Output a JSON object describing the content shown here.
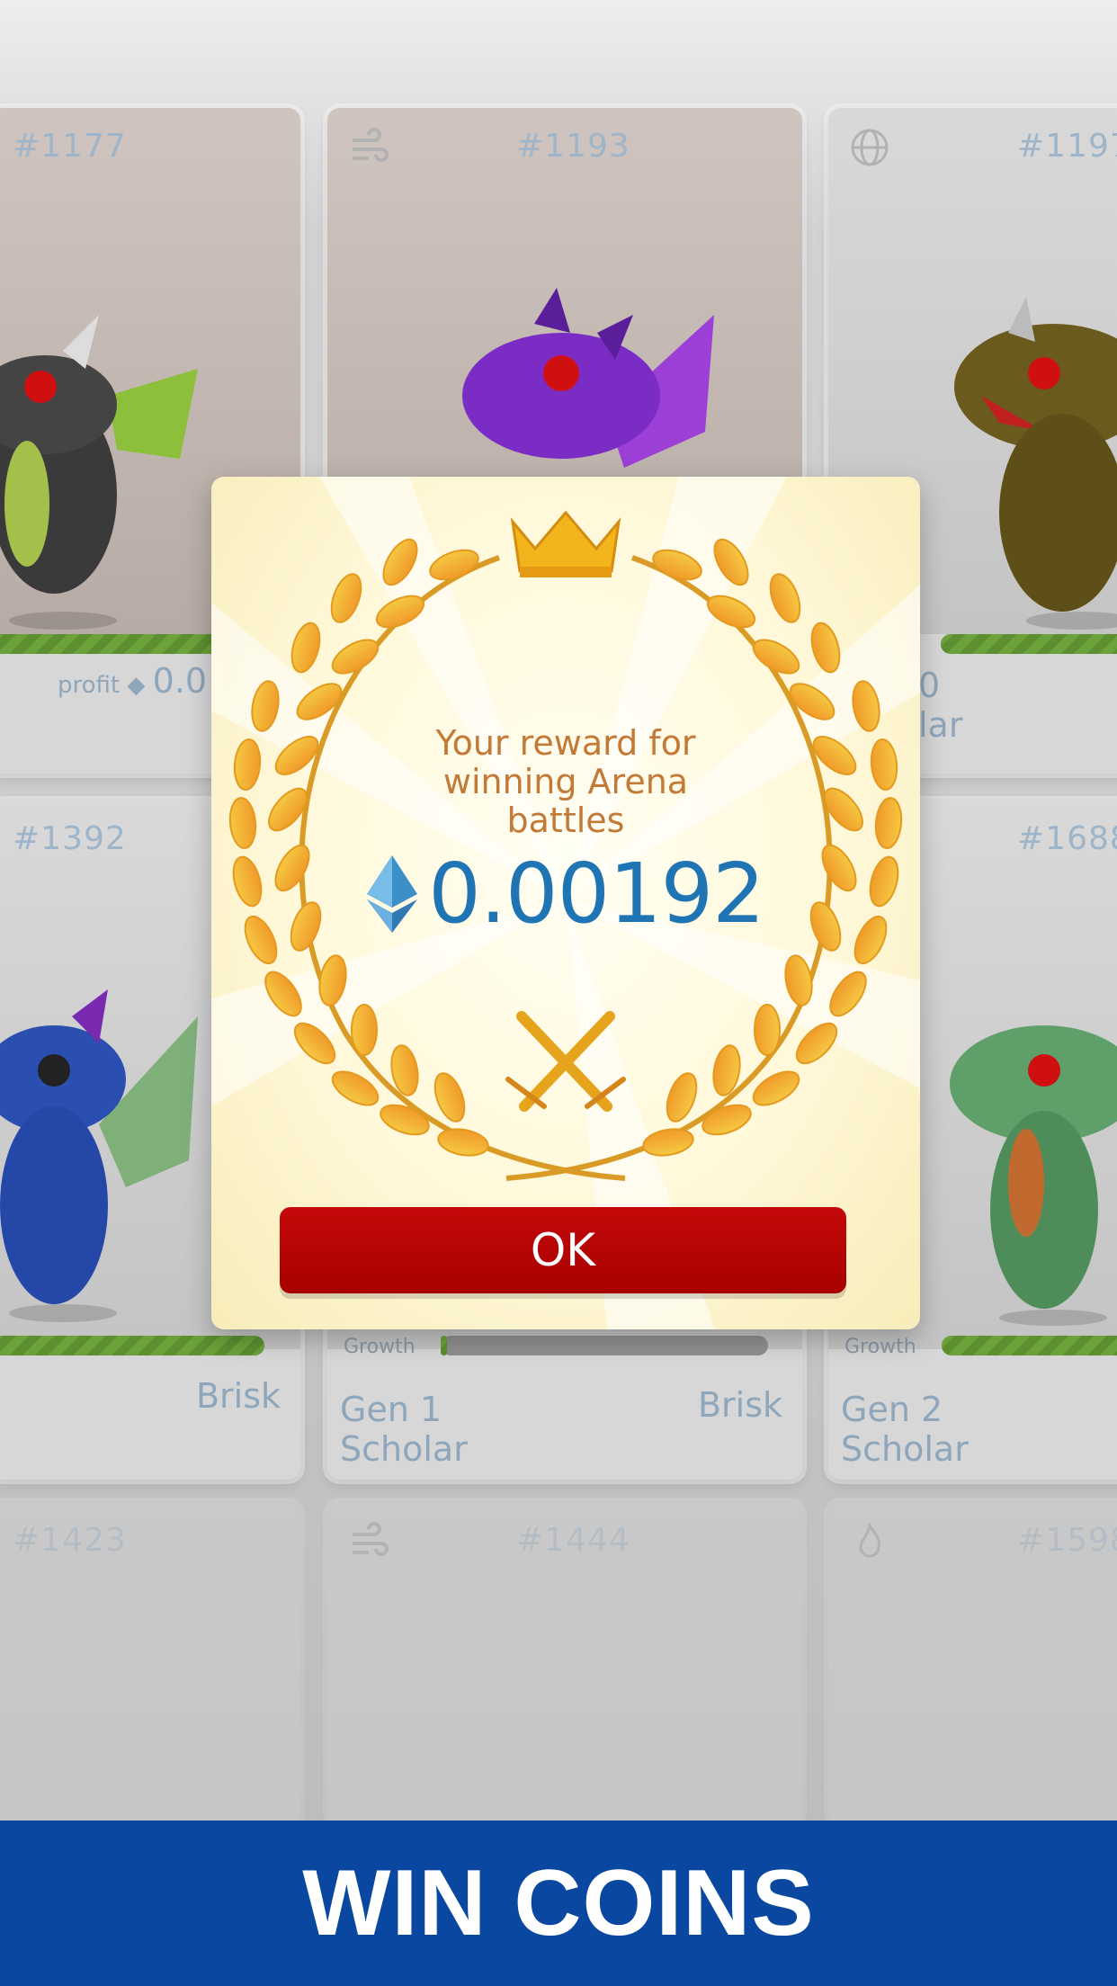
{
  "grid": {
    "cards": [
      {
        "number": "#1177",
        "profit_label": "profit",
        "profit_value": "0.0"
      },
      {
        "number": "#1193"
      },
      {
        "number": "#1197",
        "gen_partial": "0",
        "trait_partial": "lar"
      },
      {
        "number": "#1392",
        "trait": "Brisk"
      },
      {
        "growth_label": "Growth",
        "gen": "Gen 1",
        "class": "Scholar",
        "trait": "Brisk"
      },
      {
        "number": "#1688",
        "growth_label": "Growth",
        "gen": "Gen 2",
        "class": "Scholar"
      },
      {
        "number": "#1423"
      },
      {
        "number": "#1444"
      },
      {
        "number": "#1598"
      }
    ]
  },
  "modal": {
    "reward_line1": "Your reward for",
    "reward_line2": "winning Arena",
    "reward_line3": "battles",
    "amount": "0.00192",
    "currency_icon": "ethereum-icon",
    "ok_label": "OK"
  },
  "banner": {
    "text": "WIN COINS"
  },
  "colors": {
    "banner": "#0a47a0",
    "ok_button": "#b80404",
    "amount": "#1f74b4",
    "reward_text": "#c27a36"
  }
}
